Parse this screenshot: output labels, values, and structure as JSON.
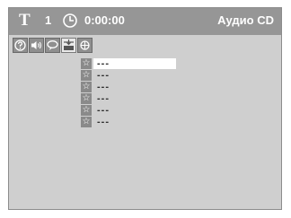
{
  "header": {
    "title_icon": "T",
    "track_number": "1",
    "clock_icon": "clock-icon",
    "time": "0:00:00",
    "disc_type": "Аудио CD"
  },
  "toolbar": {
    "buttons": [
      {
        "name": "help-icon"
      },
      {
        "name": "audio-icon"
      },
      {
        "name": "subtitle-icon"
      },
      {
        "name": "program-icon"
      },
      {
        "name": "repeat-icon"
      }
    ]
  },
  "tracks": [
    {
      "star": "☆",
      "title": "---"
    },
    {
      "star": "☆",
      "title": "---"
    },
    {
      "star": "☆",
      "title": "---"
    },
    {
      "star": "☆",
      "title": "---"
    },
    {
      "star": "☆",
      "title": "---"
    },
    {
      "star": "☆",
      "title": "---"
    }
  ],
  "colors": {
    "screen_bg": "#cfcfcf",
    "titlebar_bg": "#969696",
    "selected_row_bg": "#ffffff"
  }
}
